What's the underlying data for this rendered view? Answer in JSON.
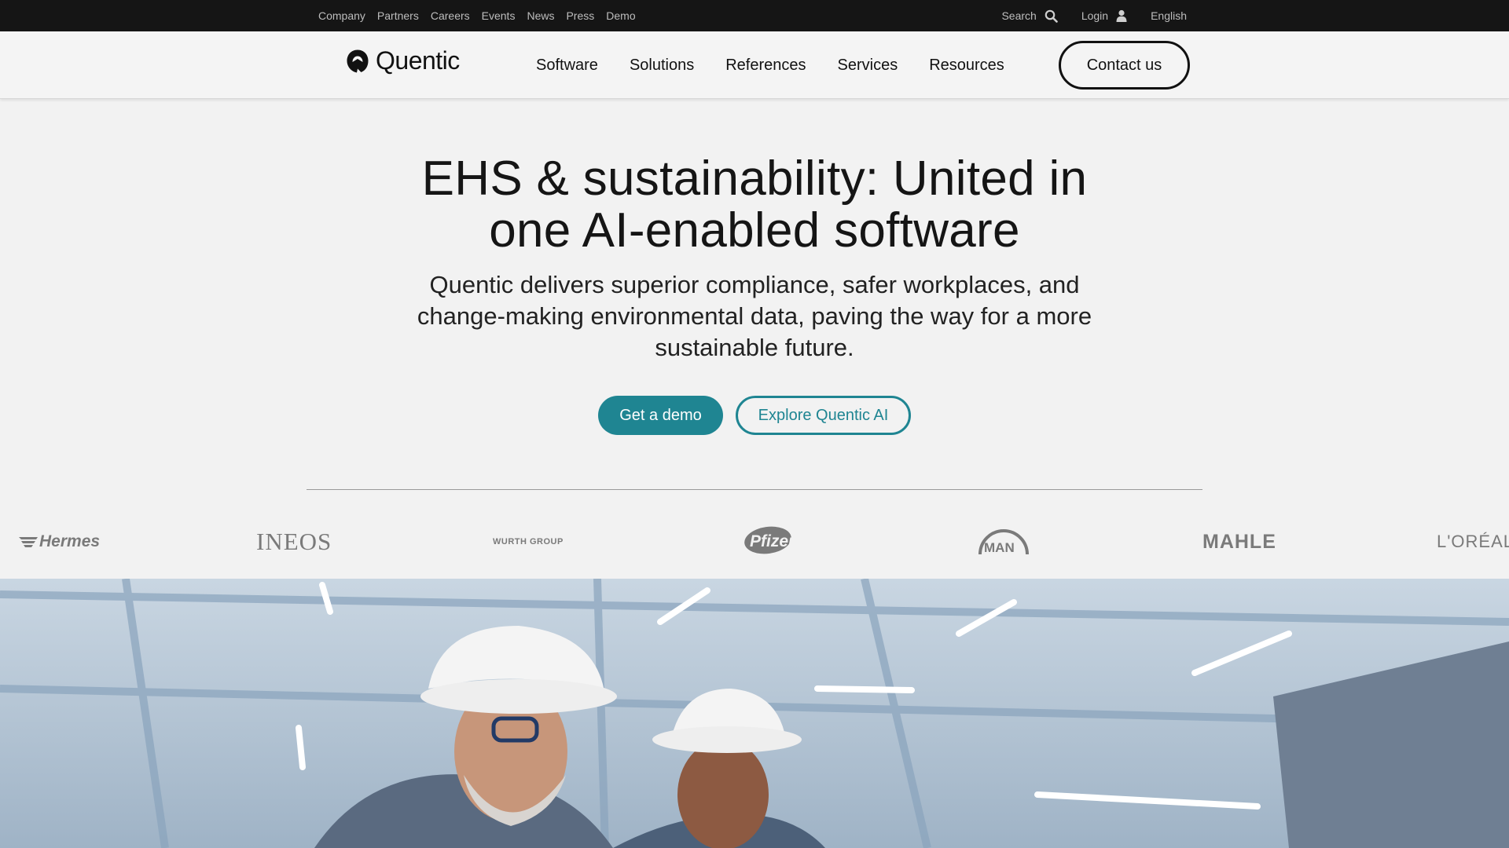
{
  "topbar": {
    "links": [
      "Company",
      "Partners",
      "Careers",
      "Events",
      "News",
      "Press",
      "Demo"
    ],
    "search_label": "Search",
    "login_label": "Login",
    "language_label": "English"
  },
  "nav": {
    "logo_text": "Quentic",
    "items": [
      "Software",
      "Solutions",
      "References",
      "Services",
      "Resources"
    ],
    "contact_label": "Contact us"
  },
  "hero": {
    "title_line1": "EHS & sustainability: United in",
    "title_line2": "one AI-enabled software",
    "subtitle": "Quentic delivers superior compliance, safer workplaces, and change-making environmental data, paving the way for a more sustainable future.",
    "cta_primary": "Get a demo",
    "cta_secondary": "Explore Quentic AI"
  },
  "customer_logos": [
    "Hermes",
    "INEOS",
    "WURTH GROUP",
    "Pfizer",
    "MAN",
    "MAHLE",
    "L'ORÉAL"
  ],
  "colors": {
    "accent": "#1f8592",
    "topbar_bg": "#151515",
    "page_bg": "#f2f2f2"
  },
  "icons": [
    "search-icon",
    "user-icon",
    "quentic-logo-icon"
  ]
}
